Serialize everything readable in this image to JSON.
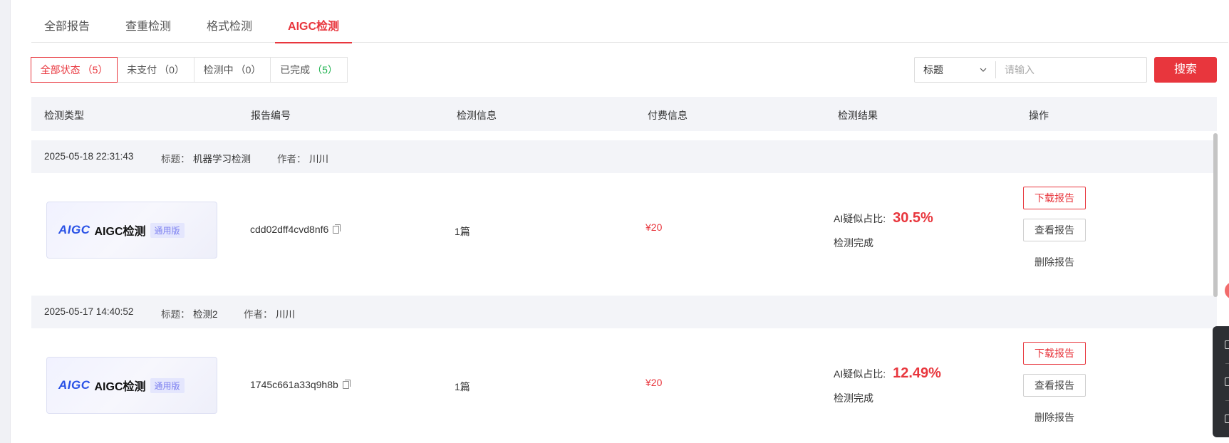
{
  "tabs": [
    {
      "label": "全部报告",
      "active": false
    },
    {
      "label": "查重检测",
      "active": false
    },
    {
      "label": "格式检测",
      "active": false
    },
    {
      "label": "AIGC检测",
      "active": true
    }
  ],
  "filters": [
    {
      "label": "全部状态",
      "count": "（5）",
      "active": true
    },
    {
      "label": "未支付",
      "count": "（0）",
      "active": false
    },
    {
      "label": "检测中",
      "count": "（0）",
      "active": false
    },
    {
      "label": "已完成",
      "count": "（5）",
      "active": false
    }
  ],
  "search": {
    "field_value": "标题",
    "placeholder": "请输入",
    "button_label": "搜索"
  },
  "table": {
    "headers": [
      "检测类型",
      "报告编号",
      "检测信息",
      "付费信息",
      "检测结果",
      "操作"
    ]
  },
  "records": [
    {
      "datetime": "2025-05-18 22:31:43",
      "title_label": "标题：",
      "title": "机器学习检测",
      "author_label": "作者：",
      "author": "川川",
      "card_logo": "AIGC",
      "card_title": "AIGC检测",
      "card_badge": "通用版",
      "report_id": "cdd02dff4cvd8nf6",
      "info": "1篇",
      "price": "¥20",
      "ratio_label": "AI疑似占比:",
      "ratio_value": "30.5%",
      "status": "检测完成",
      "op_download": "下载报告",
      "op_view": "查看报告",
      "op_delete": "删除报告"
    },
    {
      "datetime": "2025-05-17 14:40:52",
      "title_label": "标题：",
      "title": "检测2",
      "author_label": "作者：",
      "author": "川川",
      "card_logo": "AIGC",
      "card_title": "AIGC检测",
      "card_badge": "通用版",
      "report_id": "1745c661a33q9h8b",
      "info": "1篇",
      "price": "¥20",
      "ratio_label": "AI疑似占比:",
      "ratio_value": "12.49%",
      "status": "检测完成",
      "op_download": "下载报告",
      "op_view": "查看报告",
      "op_delete": "删除报告"
    }
  ],
  "colors": {
    "accent": "#e8363d",
    "success": "#21b351",
    "header_bg": "#f3f4f8"
  }
}
